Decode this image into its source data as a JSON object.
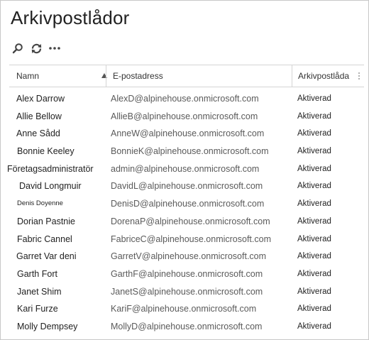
{
  "page": {
    "title": "Arkivpostlådor"
  },
  "toolbar": {
    "search_icon": "search-icon",
    "refresh_icon": "refresh-icon",
    "more_icon": "more-icon"
  },
  "columns": {
    "name": "Namn",
    "email": "E-postadress",
    "archive": "Arkivpostlåda"
  },
  "rows": [
    {
      "name": "Alex Darrow",
      "email": "AlexD@alpinehouse.onmicrosoft.com",
      "status": "Aktiverad"
    },
    {
      "name": "Allie Bellow",
      "email": "AllieB@alpinehouse.onmicrosoft.com",
      "status": "Aktiverad"
    },
    {
      "name": "Anne Sådd",
      "email": "AnneW@alpinehouse.onmicrosoft.com",
      "status": "Aktiverad"
    },
    {
      "name": "Bonnie Keeley",
      "email": "BonnieK@alpinehouse.onmicrosoft.com",
      "status": "Aktiverad"
    },
    {
      "name": "Företagsadministratör",
      "email": "admin@alpinehouse.onmicrosoft.com",
      "status": "Aktiverad"
    },
    {
      "name": "David Longmuir",
      "email": "DavidL@alpinehouse.onmicrosoft.com",
      "status": "Aktiverad"
    },
    {
      "name": "Denis Doyenne",
      "email": "DenisD@alpinehouse.onmicrosoft.com",
      "status": "Aktiverad"
    },
    {
      "name": "Dorian Pastnie",
      "email": "DorenaP@alpinehouse.onmicrosoft.com",
      "status": "Aktiverad"
    },
    {
      "name": "Fabric Cannel",
      "email": "FabriceC@alpinehouse.onmicrosoft.com",
      "status": "Aktiverad"
    },
    {
      "name": "Garret Var deni",
      "email": "GarretV@alpinehouse.onmicrosoft.com",
      "status": "Aktiverad"
    },
    {
      "name": "Garth Fort",
      "email": "GarthF@alpinehouse.onmicrosoft.com",
      "status": "Aktiverad"
    },
    {
      "name": "Janet Shim",
      "email": "JanetS@alpinehouse.onmicrosoft.com",
      "status": "Aktiverad"
    },
    {
      "name": "Kari Furze",
      "email": "KariF@alpinehouse.onmicrosoft.com",
      "status": "Aktiverad"
    },
    {
      "name": "Molly Dempsey",
      "email": "MollyD@alpinehouse.onmicrosoft.com",
      "status": "Aktiverad"
    }
  ]
}
